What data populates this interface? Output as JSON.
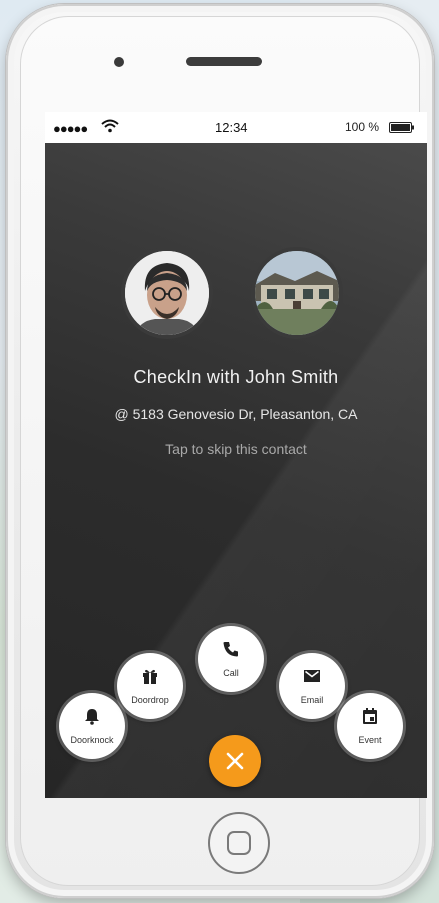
{
  "status_bar": {
    "signal": "●●●●●",
    "time": "12:34",
    "battery": "100 %"
  },
  "checkin": {
    "title": "CheckIn with John Smith",
    "address": "@ 5183 Genovesio Dr, Pleasanton, CA",
    "skip_hint": "Tap to skip this contact"
  },
  "actions": {
    "doorknock": "Doorknock",
    "doordrop": "Doordrop",
    "call": "Call",
    "email": "Email",
    "event": "Event"
  },
  "colors": {
    "accent": "#f59a1b",
    "screen_bg": "#2b2b2b"
  },
  "icons": {
    "doorknock": "bell-icon",
    "doordrop": "gift-icon",
    "call": "phone-icon",
    "email": "envelope-icon",
    "event": "calendar-icon",
    "close": "close-icon"
  }
}
